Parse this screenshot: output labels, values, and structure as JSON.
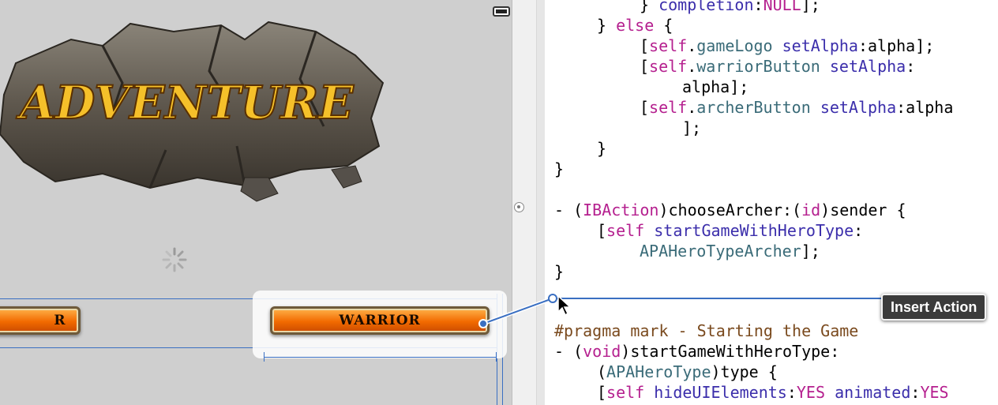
{
  "canvas": {
    "logo_text": "ADVENTURE",
    "archer_button_label": "ARCHER",
    "archer_button_visible": "R",
    "warrior_button_label": "WARRIOR"
  },
  "editor": {
    "lines": [
      "} completion:NULL];",
      "} else {",
      "[self.gameLogo setAlpha:alpha];",
      "[self.warriorButton setAlpha:",
      "alpha];",
      "[self.archerButton setAlpha:alpha",
      "];",
      "}",
      "}",
      "- (IBAction)chooseArcher:(id)sender {",
      "[self startGameWithHeroType:",
      "APAHeroTypeArcher];",
      "}",
      "#pragma mark - Starting the Game",
      "- (void)startGameWithHeroType:",
      "(APAHeroType)type {",
      "[self hideUIElements:YES animated:YES"
    ]
  },
  "popup": {
    "insert_action_label": "Insert Action"
  },
  "colors": {
    "keyword": "#b5208f",
    "class": "#3a6b78",
    "method": "#3b2eab",
    "preprocessor": "#7a4a1e",
    "connection": "#3a6fc2"
  },
  "icons": {
    "battery": "battery-icon",
    "spinner": "activity-indicator-icon",
    "cursor": "arrow-cursor-icon",
    "breakpoint": "breakpoint-marker-icon"
  }
}
